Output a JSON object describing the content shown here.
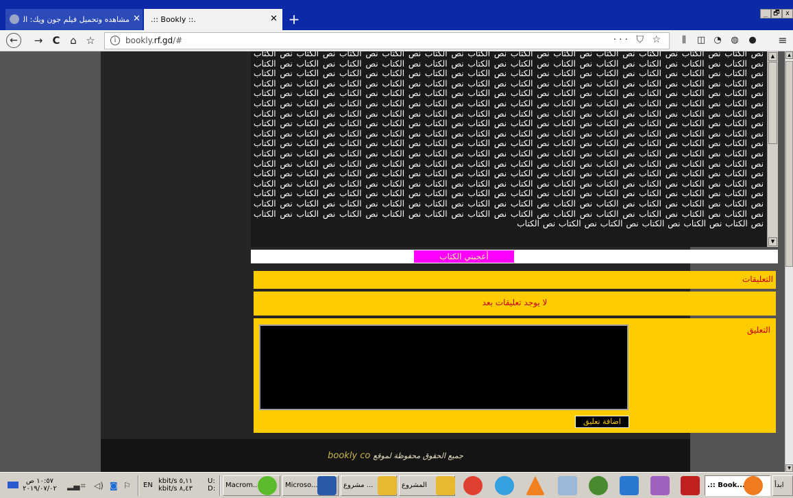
{
  "browser": {
    "tabs": [
      {
        "title": "مشاهده وتحميل فيلم جون ويك: الف",
        "close": "✕"
      },
      {
        "title": ".:: Bookly ::.",
        "close": "✕"
      }
    ],
    "new_tab": "+",
    "window_controls": [
      "_",
      "🗗",
      "x"
    ],
    "url": {
      "prefix": "bookly.",
      "domain": "rf.gd",
      "suffix": "/#"
    },
    "url_actions": "··· ⛉ ☆",
    "toolbar_icons": [
      "library-icon",
      "sidebar-icon",
      "extension-icon",
      "extension-icon-2",
      "account-icon",
      "menu-icon"
    ],
    "nav_icons": {
      "back": "←",
      "forward": "→",
      "reload": "C",
      "home": "⌂",
      "bookmark": "☆"
    }
  },
  "page": {
    "book_text_phrase": "نص الكتاب",
    "book_text_repeat": 210,
    "like_button": "أعجبني الكتاب",
    "comments_header": "التعليقات",
    "no_comments": "لا يوجد تعليقات بعد",
    "comment_label": "التعليق",
    "add_comment_button": "اضافة تعليق",
    "footer_text": "جميع الحقوق محفوظة لموقع",
    "footer_brand": "bookly co"
  },
  "colors": {
    "page_bg": "#555452",
    "content_bg": "#262524",
    "panel_yellow": "#ffcc00",
    "label_red": "#cc0000",
    "like_magenta": "#ff00ff",
    "tabbar_blue": "#0c2aa8"
  },
  "taskbar": {
    "clock_time": "١٠:٥٧ ص",
    "clock_date": "٢٠١٩/٠٧/٠٢",
    "language": "EN",
    "net_up": "kbit/s ٥,١١",
    "net_down": "kbit/s ٨,٤٣",
    "net_u_label": "U:",
    "net_d_label": "D:",
    "buttons": [
      "Macrom...",
      "Microso...",
      "مشروع ...",
      "المشروع",
      ".:: Book..."
    ],
    "start_label": "ابدأ"
  }
}
